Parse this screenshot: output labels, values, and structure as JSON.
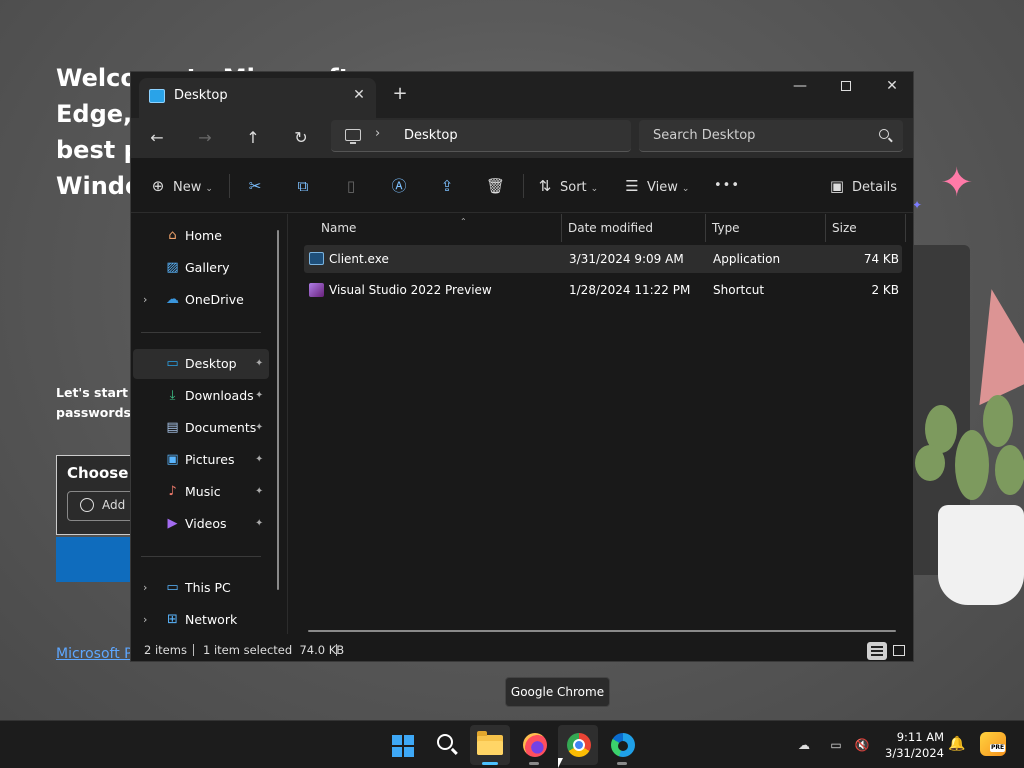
{
  "background": {
    "heading": "Welcome to Microsoft Edge, the\nbest pe\nWindo",
    "sub": "Let's start b\npasswords,",
    "card_title": "Choose a",
    "card_button": "Add",
    "link": "Microsoft Pr"
  },
  "window": {
    "tab_title": "Desktop",
    "tab_close": "✕",
    "new_tab": "+",
    "controls": {
      "minimize": "—",
      "close": "✕"
    }
  },
  "nav": {
    "back": "←",
    "forward": "→",
    "up": "↑",
    "refresh": "↻",
    "breadcrumb_chevron": "›",
    "address": "Desktop",
    "search_placeholder": "Search Desktop"
  },
  "command_bar": {
    "new_label": "New",
    "sort_label": "Sort",
    "view_label": "View",
    "more": "•••",
    "details_label": "Details",
    "icons": {
      "new": "⊕",
      "cut": "✂",
      "copy": "⧉",
      "paste": "📋",
      "rename": "Ⓐ",
      "share": "⇪",
      "delete": "🗑",
      "sort": "⇅",
      "view": "☰",
      "details": "▣"
    }
  },
  "sidebar": {
    "items": [
      {
        "label": "Home",
        "icon": "home-icon",
        "glyph": "⌂"
      },
      {
        "label": "Gallery",
        "icon": "gallery-icon",
        "glyph": "▨"
      },
      {
        "label": "OneDrive",
        "icon": "onedrive-icon",
        "glyph": "☁"
      },
      {
        "label": "Desktop",
        "icon": "desktop-icon",
        "glyph": "▭",
        "pinned": true,
        "selected": true
      },
      {
        "label": "Downloads",
        "icon": "downloads-icon",
        "glyph": "⤓",
        "pinned": true
      },
      {
        "label": "Documents",
        "icon": "documents-icon",
        "glyph": "▤",
        "pinned": true
      },
      {
        "label": "Pictures",
        "icon": "pictures-icon",
        "glyph": "▣",
        "pinned": true
      },
      {
        "label": "Music",
        "icon": "music-icon",
        "glyph": "♪",
        "pinned": true
      },
      {
        "label": "Videos",
        "icon": "videos-icon",
        "glyph": "▶",
        "pinned": true
      },
      {
        "label": "This PC",
        "icon": "this-pc-icon",
        "glyph": "▭"
      },
      {
        "label": "Network",
        "icon": "network-icon",
        "glyph": "⊞"
      }
    ],
    "pin_glyph": "📌",
    "expand_glyph": "›"
  },
  "file_list": {
    "columns": [
      "Name",
      "Date modified",
      "Type",
      "Size"
    ],
    "sort_indicator": "⌃",
    "rows": [
      {
        "name": "Client.exe",
        "date": "3/31/2024 9:09 AM",
        "type": "Application",
        "size": "74 KB",
        "selected": true
      },
      {
        "name": "Visual Studio 2022 Preview",
        "date": "1/28/2024 11:22 PM",
        "type": "Shortcut",
        "size": "2 KB"
      }
    ]
  },
  "status": {
    "items": "2 items",
    "selection": "1 item selected  74.0 KB"
  },
  "tooltip": "Google Chrome",
  "taskbar": {
    "time": "9:11 AM",
    "date": "3/31/2024",
    "apps": [
      "start",
      "search",
      "file-explorer",
      "firefox",
      "chrome",
      "edge"
    ],
    "tray": {
      "cloud_off": "☁",
      "display": "▭",
      "volume": "🔈",
      "bell": "🔔"
    }
  },
  "colors": {
    "accent": "#4cc2ff",
    "window_bg": "#191919",
    "selection": "#2d2d2d"
  }
}
